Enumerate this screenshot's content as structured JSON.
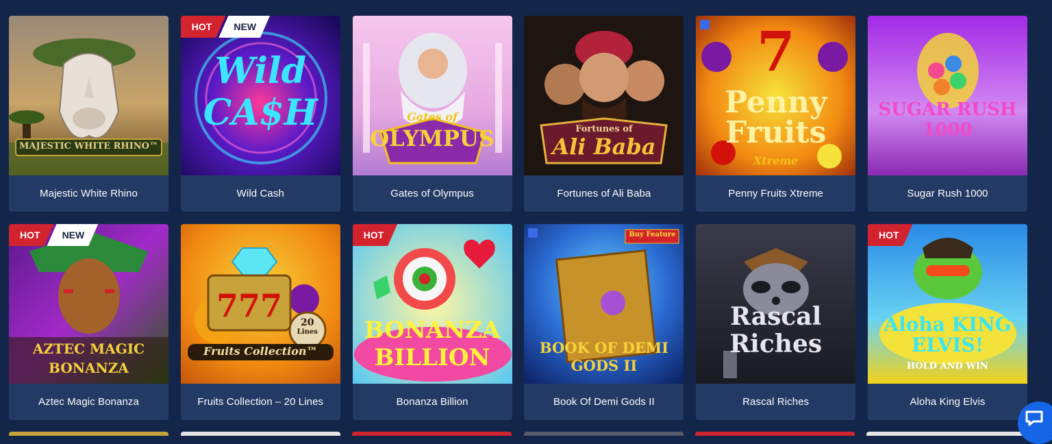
{
  "games": [
    {
      "title": "Majestic White Rhino",
      "logo": "MAJESTIC WHITE RHINO™",
      "badges": [],
      "colors": [
        "#c79a5a",
        "#6a5a3a"
      ],
      "icon": "rhino-art"
    },
    {
      "title": "Wild Cash",
      "logo": "Wild CA$H",
      "badges": [
        "HOT",
        "NEW"
      ],
      "colors": [
        "#3a1a9a",
        "#ff2a7a"
      ],
      "icon": "wild-cash-art"
    },
    {
      "title": "Gates of Olympus",
      "logo": "OLYMPUS",
      "badges": [],
      "colors": [
        "#f2b6e6",
        "#9a4ac8"
      ],
      "icon": "zeus-art"
    },
    {
      "title": "Fortunes of Ali Baba",
      "logo": "Ali Baba",
      "badges": [],
      "colors": [
        "#3a1e12",
        "#7a1a3a"
      ],
      "icon": "ali-baba-art"
    },
    {
      "title": "Penny Fruits Xtreme",
      "logo": "Penny Fruits",
      "badges": [],
      "colors": [
        "#e65a12",
        "#f2c21a"
      ],
      "icon": "penny-fruits-art"
    },
    {
      "title": "Sugar Rush 1000",
      "logo": "SUGAR RUSH 1000",
      "badges": [],
      "colors": [
        "#b23ae6",
        "#e6a2f2"
      ],
      "icon": "sugar-rush-art"
    },
    {
      "title": "Aztec Magic Bonanza",
      "logo": "AZTEC MAGIC BONANZA",
      "badges": [
        "HOT",
        "NEW"
      ],
      "colors": [
        "#7a2aa2",
        "#2a6a2a"
      ],
      "icon": "aztec-art"
    },
    {
      "title": "Fruits Collection – 20 Lines",
      "logo": "Fruits Collection™",
      "badges": [],
      "colors": [
        "#f28a12",
        "#f2c21a"
      ],
      "icon": "fruits-collection-art"
    },
    {
      "title": "Bonanza Billion",
      "logo": "BONANZA BILLION",
      "badges": [
        "HOT"
      ],
      "colors": [
        "#f2e642",
        "#3ab2f2"
      ],
      "icon": "bonanza-billion-art"
    },
    {
      "title": "Book Of Demi Gods II",
      "logo": "BOOK OF DEMI GODS II",
      "badges": [],
      "colors": [
        "#1a3a8a",
        "#2a8ae6"
      ],
      "icon": "book-art"
    },
    {
      "title": "Rascal Riches",
      "logo": "Rascal Riches",
      "badges": [],
      "colors": [
        "#2a2a3a",
        "#5a5a6a"
      ],
      "icon": "raccoon-art"
    },
    {
      "title": "Aloha King Elvis",
      "logo": "Aloha KING ELVIS!",
      "badges": [
        "HOT"
      ],
      "colors": [
        "#2a9ae6",
        "#f2d21a"
      ],
      "icon": "elvis-frog-art"
    }
  ],
  "extra_logo_text": {
    "penny_sub": "Xtreme",
    "fruits_lines": "20",
    "fruits_lines_label": "Lines",
    "book_buy": "Buy Feature",
    "elvis_sub": "HOLD AND WIN",
    "gates_top": "Gates of",
    "alibaba_top": "Fortunes of",
    "sugar_num": "1000"
  },
  "next_row_strip_colors": [
    "#c8a23a",
    "#e6e6e6",
    "#2a6ae6",
    "#d2232f",
    "#4a4a5a",
    "#d2232f"
  ],
  "chat": {
    "icon": "chat-bubble-icon"
  }
}
